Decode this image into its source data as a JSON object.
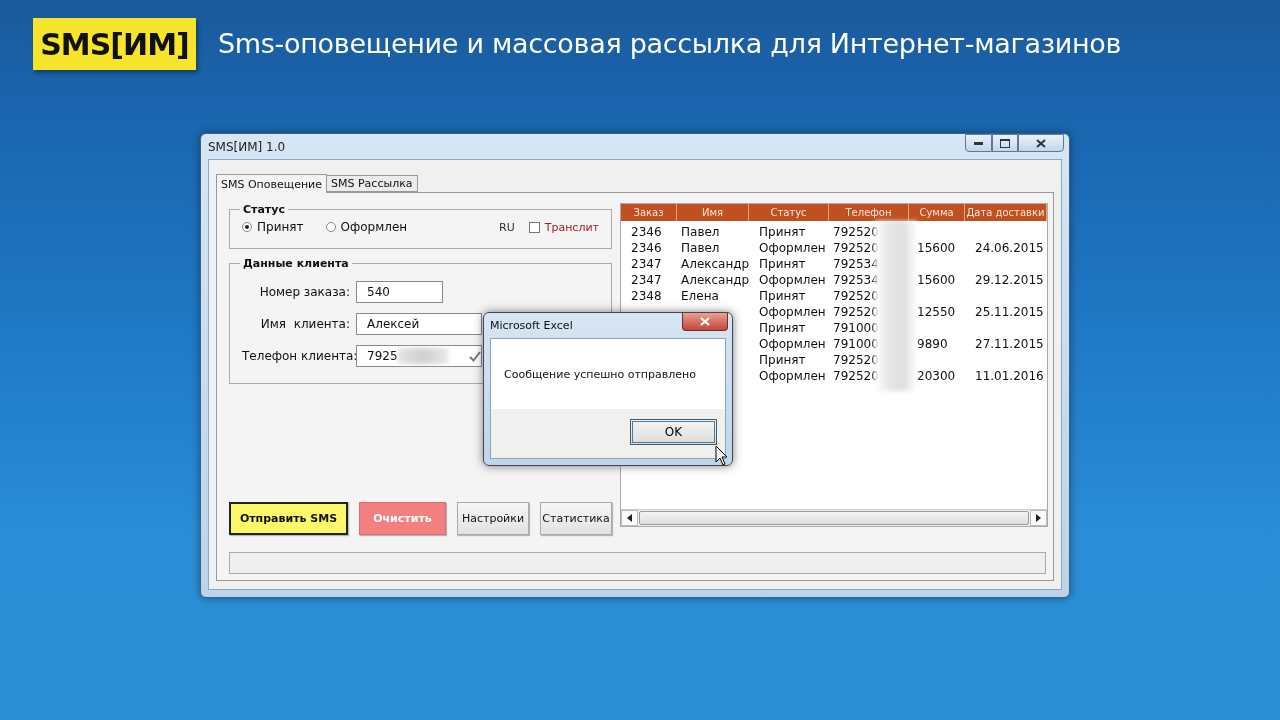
{
  "header": {
    "logo": "SMS[ИМ]",
    "title": "Sms-оповещение и массовая рассылка для Интернет-магазинов"
  },
  "window": {
    "title": "SMS[ИМ] 1.0"
  },
  "tabs": [
    {
      "label": "SMS Оповещение",
      "selected": true
    },
    {
      "label": "SMS Рассылка",
      "selected": false
    }
  ],
  "status_group": {
    "title": "Статус",
    "options": [
      {
        "label": "Принят",
        "selected": true
      },
      {
        "label": "Оформлен",
        "selected": false
      }
    ],
    "language": "RU",
    "translit": {
      "label": "Транслит",
      "checked": false
    }
  },
  "client_group": {
    "title": "Данные клиента",
    "fields": [
      {
        "label": "Номер заказа:",
        "value": "540",
        "kind": "short",
        "verified": false
      },
      {
        "label": "Имя  клиента:",
        "value": "Алексей",
        "kind": "wide",
        "verified": false
      },
      {
        "label": "Телефон клиента:",
        "value": "7925",
        "kind": "wide",
        "verified": true
      }
    ]
  },
  "buttons": [
    {
      "label": "Отправить SMS",
      "kind": "primary"
    },
    {
      "label": "Очистить",
      "kind": "danger"
    },
    {
      "label": "Настройки",
      "kind": "normal"
    },
    {
      "label": "Статистика",
      "kind": "normal"
    }
  ],
  "table": {
    "columns": [
      "Заказ",
      "Имя",
      "Статус",
      "Телефон",
      "Сумма",
      "Дата доставки"
    ],
    "rows": [
      {
        "order": "2346",
        "name": "Павел",
        "status": "Принят",
        "phone": "792520"
      },
      {
        "order": "2346",
        "name": "Павел",
        "status": "Оформлен",
        "phone": "792520",
        "sum": "15600",
        "date": "24.06.2015"
      },
      {
        "order": "2347",
        "name": "Александр",
        "status": "Принят",
        "phone": "792534"
      },
      {
        "order": "2347",
        "name": "Александр",
        "status": "Оформлен",
        "phone": "792534",
        "sum": "15600",
        "date": "29.12.2015"
      },
      {
        "order": "2348",
        "name": "Елена",
        "status": "Принят",
        "phone": "792520"
      },
      {
        "status": "Оформлен",
        "phone": "792520",
        "sum": "12550",
        "date": "25.11.2015"
      },
      {
        "status": "Принят",
        "phone": "791000"
      },
      {
        "status": "Оформлен",
        "phone": "791000",
        "sum": "9890",
        "date": "27.11.2015"
      },
      {
        "status": "Принят",
        "phone": "792520"
      },
      {
        "status": "Оформлен",
        "phone": "792520",
        "sum": "20300",
        "date": "11.01.2016"
      }
    ]
  },
  "dialog": {
    "title": "Microsoft Excel",
    "message": "Сообщение успешно отправлено",
    "button": "OK"
  }
}
